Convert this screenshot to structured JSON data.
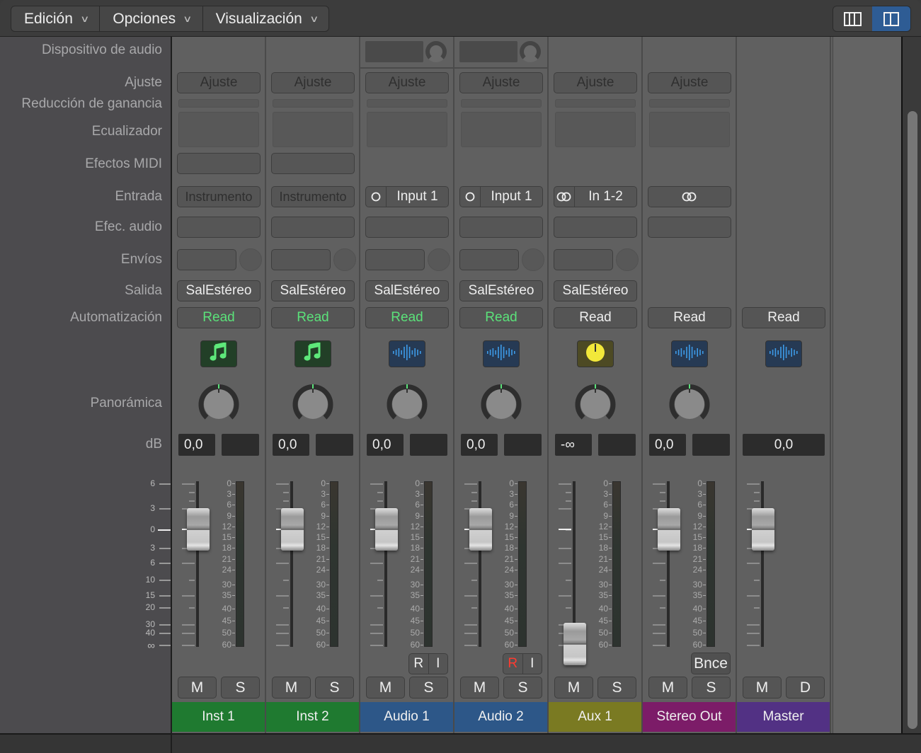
{
  "toolbar": {
    "menus": [
      {
        "label": "Edición"
      },
      {
        "label": "Opciones"
      },
      {
        "label": "Visualización"
      }
    ],
    "view_buttons": [
      {
        "name": "three-column-view",
        "active": false
      },
      {
        "name": "two-column-view",
        "active": true
      }
    ]
  },
  "row_labels": {
    "device": "Dispositivo de audio",
    "setting": "Ajuste",
    "gain_reduction": "Reducción de ganancia",
    "eq": "Ecualizador",
    "midi_fx": "Efectos MIDI",
    "input": "Entrada",
    "audio_fx": "Efec. audio",
    "sends": "Envíos",
    "output": "Salida",
    "automation": "Automatización",
    "pan": "Panorámica",
    "db": "dB"
  },
  "fader_scale": [
    "6",
    "3",
    "0",
    "3",
    "6",
    "10",
    "15",
    "20",
    "30",
    "40",
    "∞"
  ],
  "meter_scale": [
    "0",
    "3",
    "6",
    "9",
    "12",
    "15",
    "18",
    "21",
    "24",
    "30",
    "35",
    "40",
    "45",
    "50",
    "60"
  ],
  "colors": {
    "inst": "#1f7a30",
    "audio": "#2d5788",
    "aux": "#7a7a22",
    "stereo_out": "#7c1c68",
    "master": "#523184",
    "read_green": "#5be27a",
    "record_red": "#ff3b30"
  },
  "strips": [
    {
      "name": "Inst 1",
      "type": "instrument",
      "setting": "Ajuste",
      "input": "Instrumento",
      "output": "SalEstéreo",
      "automation": "Read",
      "volume": "0,0",
      "mute": "M",
      "solo": "S",
      "icon": "music-note-icon"
    },
    {
      "name": "Inst 2",
      "type": "instrument",
      "setting": "Ajuste",
      "input": "Instrumento",
      "output": "SalEstéreo",
      "automation": "Read",
      "volume": "0,0",
      "mute": "M",
      "solo": "S",
      "icon": "music-note-icon"
    },
    {
      "name": "Audio 1",
      "type": "audio",
      "setting": "Ajuste",
      "input": "Input 1",
      "output": "SalEstéreo",
      "automation": "Read",
      "volume": "0,0",
      "mute": "M",
      "solo": "S",
      "record": "R",
      "input_monitor": "I",
      "record_armed": false,
      "icon": "waveform-icon"
    },
    {
      "name": "Audio 2",
      "type": "audio",
      "setting": "Ajuste",
      "input": "Input 1",
      "output": "SalEstéreo",
      "automation": "Read",
      "volume": "0,0",
      "mute": "M",
      "solo": "S",
      "record": "R",
      "input_monitor": "I",
      "record_armed": true,
      "icon": "waveform-icon"
    },
    {
      "name": "Aux 1",
      "type": "aux",
      "setting": "Ajuste",
      "input": "In 1-2",
      "output": "SalEstéreo",
      "automation": "Read",
      "volume": "-∞",
      "mute": "M",
      "solo": "S",
      "icon": "knob-icon"
    },
    {
      "name": "Stereo Out",
      "type": "output",
      "setting": "Ajuste",
      "input": "",
      "output": "",
      "automation": "Read",
      "volume": "0,0",
      "mute": "M",
      "solo": "S",
      "bounce": "Bnce",
      "icon": "waveform-icon"
    },
    {
      "name": "Master",
      "type": "master",
      "automation": "Read",
      "volume": "0,0",
      "mute": "M",
      "dim": "D",
      "icon": "waveform-icon"
    }
  ]
}
